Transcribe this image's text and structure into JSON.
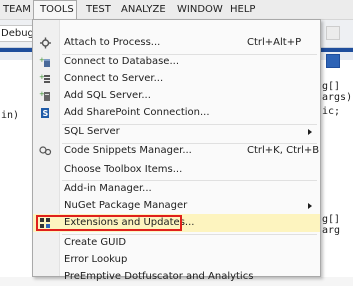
{
  "menubar": {
    "items": [
      {
        "label": "TEAM"
      },
      {
        "label": "TOOLS"
      },
      {
        "label": "TEST"
      },
      {
        "label": "ANALYZE"
      },
      {
        "label": "WINDOW"
      },
      {
        "label": "HELP"
      }
    ]
  },
  "toolbar": {
    "configuration_value": "Debug"
  },
  "code": {
    "frag_left": "in)",
    "frag_top_right": "g[] args)",
    "frag_mid_right": "ic;",
    "frag_bottom_right": "g[] arg"
  },
  "tools_menu": {
    "items": [
      {
        "label": "Attach to Process...",
        "shortcut": "Ctrl+Alt+P",
        "icon": "attach-process-icon"
      },
      {
        "label": "Connect to Database...",
        "icon": "connect-database-icon"
      },
      {
        "label": "Connect to Server...",
        "icon": "connect-server-icon"
      },
      {
        "label": "Add SQL Server...",
        "icon": "add-sql-server-icon"
      },
      {
        "label": "Add SharePoint Connection...",
        "icon": "sharepoint-icon"
      },
      {
        "label": "SQL Server",
        "submenu": true
      },
      {
        "label": "Code Snippets Manager...",
        "shortcut": "Ctrl+K, Ctrl+B",
        "icon": "code-snippets-icon"
      },
      {
        "label": "Choose Toolbox Items..."
      },
      {
        "label": "Add-in Manager..."
      },
      {
        "label": "NuGet Package Manager",
        "submenu": true
      },
      {
        "label": "Extensions and Updates...",
        "icon": "extensions-icon",
        "highlighted": true
      },
      {
        "label": "Create GUID"
      },
      {
        "label": "Error Lookup"
      },
      {
        "label": "PreEmptive Dotfuscator and Analytics"
      }
    ]
  },
  "colors": {
    "highlight_border": "#e0201b",
    "highlight_fill": "#fdf4bf",
    "accent_blue": "#1f4e9c"
  }
}
